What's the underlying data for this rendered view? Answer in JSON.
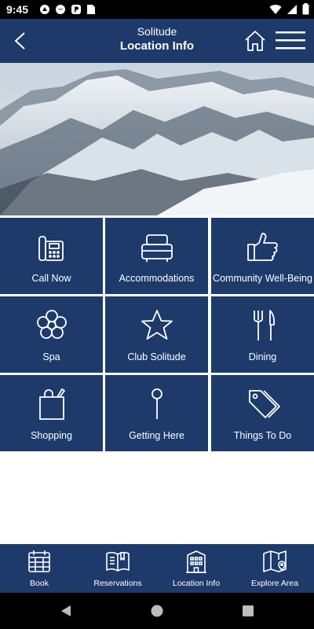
{
  "status_bar": {
    "time": "9:45",
    "left_icons": [
      "signal-icon",
      "messenger-icon",
      "p-icon",
      "sim-card-icon"
    ],
    "right_icons": [
      "wifi-icon",
      "cell-signal-icon",
      "battery-icon"
    ]
  },
  "header": {
    "subtitle": "Solitude",
    "title": "Location Info",
    "back_icon": "chevron-left-icon",
    "home_icon": "home-icon",
    "menu_icon": "hamburger-menu-icon"
  },
  "hero": {
    "description_icon": "mountain-photo"
  },
  "tiles": [
    {
      "label": "Call Now",
      "icon": "phone-icon"
    },
    {
      "label": "Accommodations",
      "icon": "bed-icon"
    },
    {
      "label": "Community Well-Being",
      "icon": "thumbs-up-icon"
    },
    {
      "label": "Spa",
      "icon": "flower-icon"
    },
    {
      "label": "Club Solitude",
      "icon": "star-icon"
    },
    {
      "label": "Dining",
      "icon": "fork-knife-icon"
    },
    {
      "label": "Shopping",
      "icon": "shopping-bag-icon"
    },
    {
      "label": "Getting Here",
      "icon": "map-pin-icon"
    },
    {
      "label": "Things To Do",
      "icon": "tags-icon"
    }
  ],
  "tabs": [
    {
      "label": "Book",
      "icon": "calendar-icon"
    },
    {
      "label": "Reservations",
      "icon": "book-icon"
    },
    {
      "label": "Location Info",
      "icon": "building-icon"
    },
    {
      "label": "Explore Area",
      "icon": "map-icon"
    }
  ],
  "colors": {
    "primary": "#1d3a6a",
    "background": "#ffffff",
    "bar": "#000000"
  }
}
